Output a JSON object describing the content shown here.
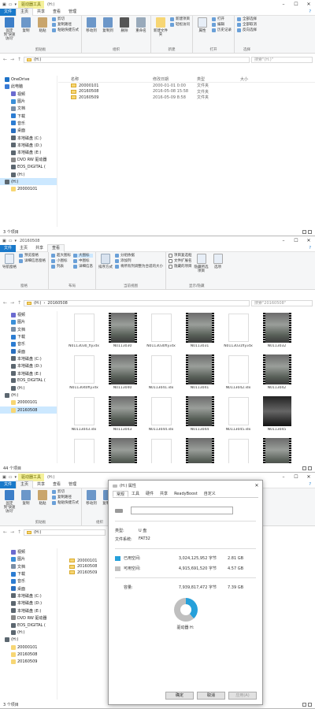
{
  "windows": [
    {
      "title": "(H:)",
      "context_tab": "驱动器工具",
      "tabs": [
        "文件",
        "主页",
        "共享",
        "查看",
        "管理"
      ],
      "ribbon": [
        {
          "label": "剪贴板",
          "big": [
            "固定到'快速访问'",
            "复制",
            "粘贴"
          ],
          "small": [
            "剪切",
            "复制路径",
            "粘贴快捷方式"
          ]
        },
        {
          "label": "组织",
          "big": [
            "移动到",
            "复制到",
            "删除",
            "重命名"
          ],
          "small": []
        },
        {
          "label": "新建",
          "big": [
            "新建文件夹"
          ],
          "small": [
            "新建项目",
            "轻松访问"
          ]
        },
        {
          "label": "打开",
          "big": [
            "属性"
          ],
          "small": [
            "打开",
            "编辑",
            "历史记录"
          ]
        },
        {
          "label": "选择",
          "big": [],
          "small": [
            "全部选择",
            "全部取消",
            "反向选择"
          ]
        }
      ],
      "path": [
        "(H:)"
      ],
      "search": "搜索\"(H:)\"",
      "nav": [
        {
          "label": "OneDrive",
          "level": 1,
          "color": "#1e73c8"
        },
        {
          "label": "此电脑",
          "level": 1,
          "color": "#3a7bd5"
        },
        {
          "label": "视频",
          "level": 2,
          "color": "#6b6bd0"
        },
        {
          "label": "图片",
          "level": 2,
          "color": "#3b90d8"
        },
        {
          "label": "文档",
          "level": 2,
          "color": "#7a8fa6"
        },
        {
          "label": "下载",
          "level": 2,
          "color": "#2d7dd2"
        },
        {
          "label": "音乐",
          "level": 2,
          "color": "#2d7dd2"
        },
        {
          "label": "桌面",
          "level": 2,
          "color": "#2a6fbf"
        },
        {
          "label": "本地磁盘 (C:)",
          "level": 2,
          "color": "#5c6770"
        },
        {
          "label": "本地磁盘 (D:)",
          "level": 2,
          "color": "#5c6770"
        },
        {
          "label": "本地磁盘 (E:)",
          "level": 2,
          "color": "#5c6770"
        },
        {
          "label": "DVD RW 驱动器",
          "level": 2,
          "color": "#8a8a8a"
        },
        {
          "label": "EOS_DIGITAL (",
          "level": 2,
          "color": "#5c6770"
        },
        {
          "label": "(H:)",
          "level": 2,
          "color": "#5c6770"
        },
        {
          "label": "(H:)",
          "level": 1,
          "color": "#5c6770",
          "selected": true
        },
        {
          "label": "20000101",
          "level": 2,
          "color": "#f7d674"
        }
      ],
      "columns": [
        "名称",
        "修改日期",
        "类型",
        "大小"
      ],
      "files": [
        {
          "name": "20000101",
          "date": "2000-01-01 0:00",
          "type": "文件夹"
        },
        {
          "name": "20160508",
          "date": "2016-05-08 15:58",
          "type": "文件夹"
        },
        {
          "name": "20160509",
          "date": "2016-05-09 8:58",
          "type": "文件夹"
        }
      ],
      "status": "3 个项目"
    },
    {
      "title": "20160508",
      "tabs": [
        "文件",
        "主页",
        "共享",
        "查看"
      ],
      "ribbon": [
        {
          "label": "窗格",
          "big": [
            "导航窗格"
          ],
          "small": [
            "预览窗格",
            "详细信息窗格"
          ]
        },
        {
          "label": "布局",
          "big": [],
          "small": [
            "超大图标",
            "大图标",
            "中图标",
            "小图标",
            "列表",
            "详细信息"
          ]
        },
        {
          "label": "当前视图",
          "big": [
            "排序方式"
          ],
          "small": [
            "分组依据",
            "添加列",
            "将所有列调整为合适的大小"
          ]
        },
        {
          "label": "显示/隐藏",
          "big": [
            "隐藏所选项目",
            "选项"
          ],
          "small": [
            "项目复选框",
            "文件扩展名",
            "隐藏的项目"
          ]
        }
      ],
      "path": [
        "(H:)",
        "20160508"
      ],
      "search": "搜索\"20160508\"",
      "nav": [
        {
          "label": "视频",
          "level": 2,
          "color": "#6b6bd0"
        },
        {
          "label": "图片",
          "level": 2,
          "color": "#3b90d8"
        },
        {
          "label": "文档",
          "level": 2,
          "color": "#7a8fa6"
        },
        {
          "label": "下载",
          "level": 2,
          "color": "#2d7dd2"
        },
        {
          "label": "音乐",
          "level": 2,
          "color": "#2d7dd2"
        },
        {
          "label": "桌面",
          "level": 2,
          "color": "#2a6fbf"
        },
        {
          "label": "本地磁盘 (C:)",
          "level": 2,
          "color": "#5c6770"
        },
        {
          "label": "本地磁盘 (D:)",
          "level": 2,
          "color": "#5c6770"
        },
        {
          "label": "本地磁盘 (E:)",
          "level": 2,
          "color": "#5c6770"
        },
        {
          "label": "EOS_DIGITAL (",
          "level": 2,
          "color": "#5c6770"
        },
        {
          "label": "(H:)",
          "level": 2,
          "color": "#5c6770"
        },
        {
          "label": "(H:)",
          "level": 1,
          "color": "#5c6770"
        },
        {
          "label": "20000101",
          "level": 2,
          "color": "#f7d674"
        },
        {
          "label": "20160508",
          "level": 2,
          "color": "#f7d674",
          "selected": true
        }
      ],
      "tiles": [
        {
          "name": "N0113030_fly.idx",
          "kind": "doc"
        },
        {
          "name": "N0113030",
          "kind": "vid"
        },
        {
          "name": "N0113030fly.idx",
          "kind": "doc"
        },
        {
          "name": "N0113031",
          "kind": "vid"
        },
        {
          "name": "N0113031fly.idx",
          "kind": "doc"
        },
        {
          "name": "N0113032",
          "kind": "vid"
        },
        {
          "name": "N0113040fly.idx",
          "kind": "doc"
        },
        {
          "name": "N0113040",
          "kind": "vid"
        },
        {
          "name": "N0113041.idx",
          "kind": "doc"
        },
        {
          "name": "N0113041",
          "kind": "vid"
        },
        {
          "name": "N0113042.idx",
          "kind": "doc"
        },
        {
          "name": "N0113042",
          "kind": "vid"
        },
        {
          "name": "N0113043.idx",
          "kind": "doc"
        },
        {
          "name": "N0113043",
          "kind": "vid"
        },
        {
          "name": "N0113044.idx",
          "kind": "doc"
        },
        {
          "name": "N0113044",
          "kind": "vid"
        },
        {
          "name": "N0113045.idx",
          "kind": "doc"
        },
        {
          "name": "N0113045",
          "kind": "dark"
        },
        {
          "name": "",
          "kind": "doc"
        },
        {
          "name": "",
          "kind": "vid"
        },
        {
          "name": "",
          "kind": "doc"
        },
        {
          "name": "",
          "kind": "vid"
        },
        {
          "name": "",
          "kind": "doc"
        },
        {
          "name": "",
          "kind": "vid"
        }
      ],
      "status": "44 个项目"
    },
    {
      "title": "(H:)",
      "context_tab": "驱动器工具",
      "tabs": [
        "文件",
        "主页",
        "共享",
        "查看",
        "管理"
      ],
      "ribbon": [
        {
          "label": "剪贴板",
          "big": [
            "固定到'快速访问'",
            "复制",
            "粘贴"
          ],
          "small": [
            "剪切",
            "复制路径",
            "粘贴快捷方式"
          ]
        },
        {
          "label": "组织",
          "big": [
            "移动到",
            "复制到"
          ],
          "small": []
        }
      ],
      "path": [
        "(H:)"
      ],
      "search": "",
      "nav": [
        {
          "label": "视频",
          "level": 2,
          "color": "#6b6bd0"
        },
        {
          "label": "图片",
          "level": 2,
          "color": "#3b90d8"
        },
        {
          "label": "文档",
          "level": 2,
          "color": "#7a8fa6"
        },
        {
          "label": "下载",
          "level": 2,
          "color": "#2d7dd2"
        },
        {
          "label": "音乐",
          "level": 2,
          "color": "#2d7dd2"
        },
        {
          "label": "桌面",
          "level": 2,
          "color": "#2a6fbf"
        },
        {
          "label": "本地磁盘 (C:)",
          "level": 2,
          "color": "#5c6770"
        },
        {
          "label": "本地磁盘 (D:)",
          "level": 2,
          "color": "#5c6770"
        },
        {
          "label": "本地磁盘 (E:)",
          "level": 2,
          "color": "#5c6770"
        },
        {
          "label": "DVD RW 驱动器",
          "level": 2,
          "color": "#8a8a8a"
        },
        {
          "label": "EOS_DIGITAL (",
          "level": 2,
          "color": "#5c6770"
        },
        {
          "label": "(H:)",
          "level": 2,
          "color": "#5c6770"
        },
        {
          "label": "(H:)",
          "level": 1,
          "color": "#5c6770"
        },
        {
          "label": "20000101",
          "level": 2,
          "color": "#f7d674"
        },
        {
          "label": "20160508",
          "level": 2,
          "color": "#f7d674"
        },
        {
          "label": "20160509",
          "level": 2,
          "color": "#f7d674"
        }
      ],
      "files": [
        {
          "name": "20000101"
        },
        {
          "name": "20160508"
        },
        {
          "name": "20160509"
        }
      ],
      "status": "3 个项目"
    }
  ],
  "dialog": {
    "title": "(H:) 属性",
    "tabs": [
      "常规",
      "工具",
      "硬件",
      "共享",
      "ReadyBoost",
      "自定义"
    ],
    "type_label": "类型:",
    "type_value": "U 盘",
    "fs_label": "文件系统:",
    "fs_value": "FAT32",
    "used_label": "已用空间:",
    "used_bytes": "3,024,125,952 字节",
    "used_size": "2.81 GB",
    "free_label": "可用空间:",
    "free_bytes": "4,915,691,520 字节",
    "free_size": "4.57 GB",
    "cap_label": "容量:",
    "cap_bytes": "7,939,817,472 字节",
    "cap_size": "7.39 GB",
    "drive_label": "驱动器 H:",
    "used_fraction": 0.381,
    "buttons": [
      "确定",
      "取消",
      "应用(A)"
    ],
    "colors": {
      "used": "#26a0da",
      "free": "#bfbfbf"
    }
  }
}
